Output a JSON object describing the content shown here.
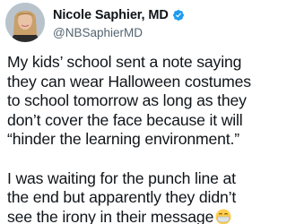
{
  "author": {
    "display_name": "Nicole Saphier, MD",
    "handle": "@NBSaphierMD",
    "verified": true,
    "verified_color": "#1d9bf0"
  },
  "tweet": {
    "paragraph_1": [
      "My kids’ school sent a note saying",
      "they can wear Halloween costumes",
      "to school tomorrow as long as they",
      "don’t cover the face because it will",
      "“hinder the learning environment.”"
    ],
    "paragraph_2": [
      "I was waiting for the punch line at",
      "the end but apparently they didn’t",
      "see the irony in their message"
    ],
    "trailing_emoji": "face-with-medical-mask-icon"
  },
  "colors": {
    "text": "#0f1419",
    "secondary_text": "#536471",
    "background": "#ffffff"
  }
}
